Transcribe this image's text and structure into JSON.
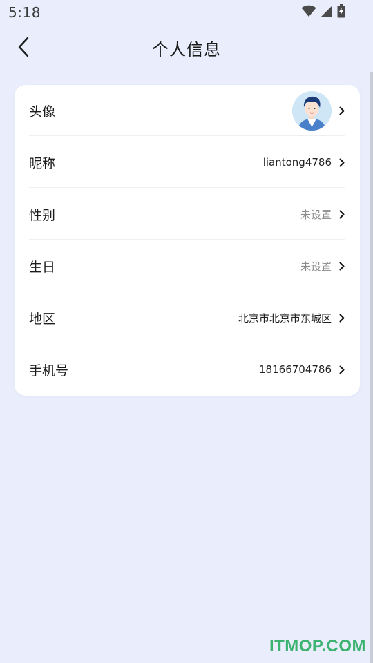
{
  "status_bar": {
    "time": "5:18",
    "icons": [
      "wifi-icon",
      "signal-icon",
      "battery-charging-icon"
    ]
  },
  "header": {
    "title": "个人信息",
    "back_icon": "chevron-left-icon"
  },
  "profile": {
    "rows": [
      {
        "label": "头像",
        "type": "avatar",
        "avatar_icon": "user-avatar-icon"
      },
      {
        "label": "昵称",
        "value": "liantong4786"
      },
      {
        "label": "性别",
        "value": "未设置"
      },
      {
        "label": "生日",
        "value": "未设置"
      },
      {
        "label": "地区",
        "value": "北京市北京市东城区"
      },
      {
        "label": "手机号",
        "value": "18166704786"
      }
    ]
  },
  "watermark": "ITMOP.COM",
  "colors": {
    "background": "#e9edfc",
    "card": "#ffffff",
    "muted_text": "#8b8b8b",
    "watermark": "#3cb371"
  }
}
